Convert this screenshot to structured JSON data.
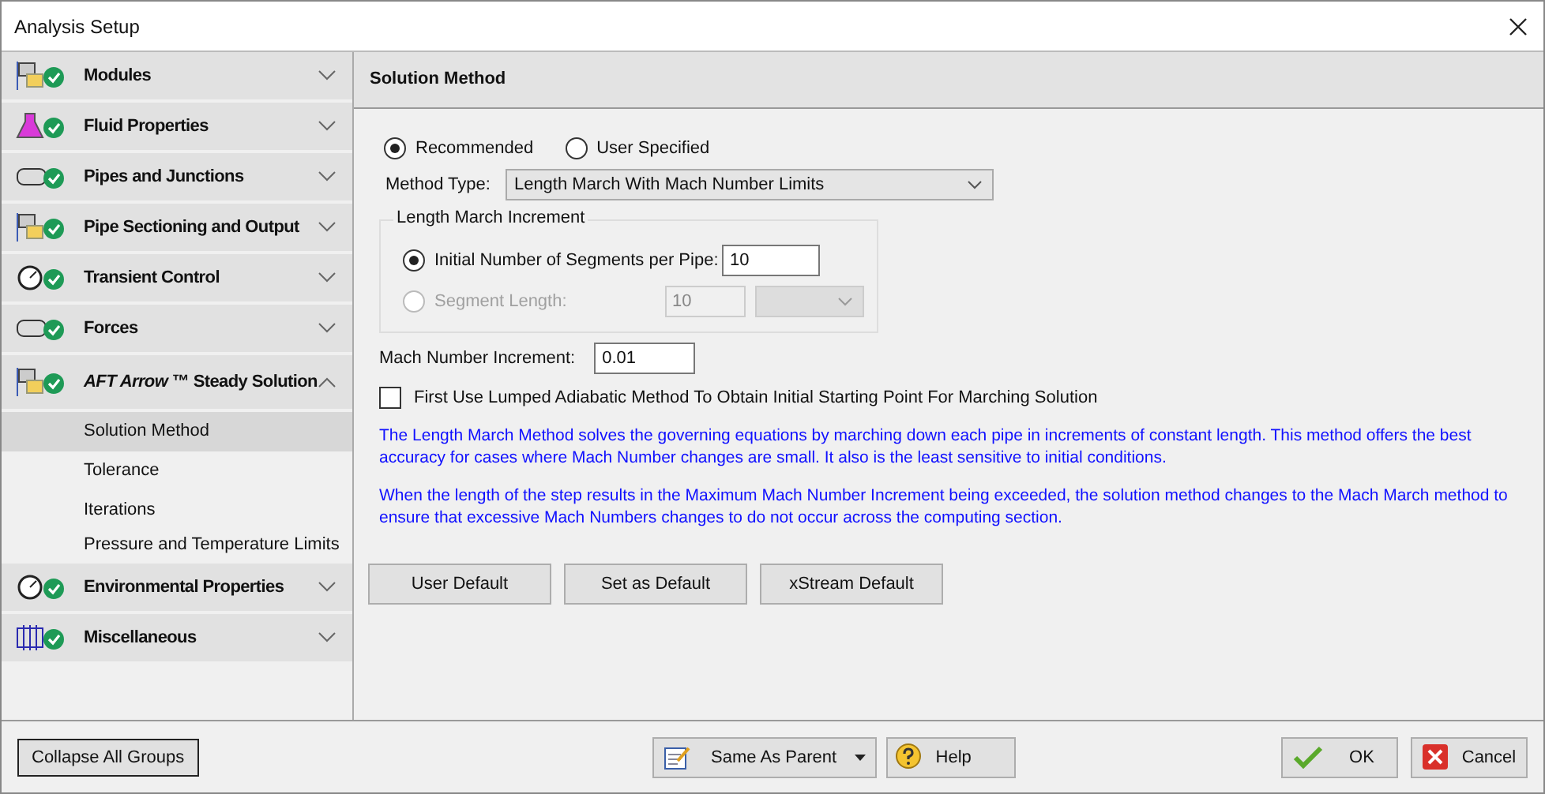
{
  "window": {
    "title": "Analysis Setup"
  },
  "sidebar": {
    "groups": [
      {
        "label": "Modules",
        "expanded": false
      },
      {
        "label": "Fluid Properties",
        "expanded": false
      },
      {
        "label": "Pipes and Junctions",
        "expanded": false
      },
      {
        "label": "Pipe Sectioning and Output",
        "expanded": false
      },
      {
        "label": "Transient Control",
        "expanded": false
      },
      {
        "label": "Forces",
        "expanded": false
      },
      {
        "label": "*AFT Arrow* ™ Steady Solution",
        "expanded": true,
        "children": [
          {
            "label": "Solution Method",
            "selected": true
          },
          {
            "label": "Tolerance",
            "selected": false
          },
          {
            "label": "Iterations",
            "selected": false
          },
          {
            "label": "Pressure and Temperature Limits",
            "selected": false
          }
        ]
      },
      {
        "label": "Environmental Properties",
        "expanded": false
      },
      {
        "label": "Miscellaneous",
        "expanded": false
      }
    ]
  },
  "panel": {
    "title": "Solution Method",
    "method_choice": [
      {
        "label": "Recommended",
        "selected": true
      },
      {
        "label": "User Specified",
        "selected": false
      }
    ],
    "method_type": {
      "label": "Method Type:",
      "value": "Length March With Mach Number Limits"
    },
    "length_march": {
      "title": "Length March Increment",
      "options": [
        {
          "label": "Initial Number of Segments per Pipe:",
          "selected": true,
          "disabled": false,
          "value": "10",
          "has_unit": false
        },
        {
          "label": "Segment Length:",
          "selected": false,
          "disabled": true,
          "value": "10",
          "has_unit": true
        }
      ]
    },
    "mach_increment": {
      "label": "Mach Number Increment:",
      "value": "0.01"
    },
    "lumped_option": {
      "label": "First Use Lumped Adiabatic Method To Obtain Initial Starting Point For Marching Solution",
      "checked": false
    },
    "notes": [
      "The Length March Method solves the governing equations by marching down each pipe in increments of constant length. This method offers the best accuracy for cases where Mach Number changes are small. It also is the least sensitive to initial conditions.",
      "When the length of the step results in the Maximum Mach Number Increment being exceeded, the solution method changes to the Mach March method to ensure that excessive Mach Numbers changes to do not occur across the computing section."
    ],
    "buttons": [
      "User Default",
      "Set as Default",
      "xStream Default"
    ]
  },
  "footer": {
    "collapse": "Collapse All Groups",
    "parent": "Same As Parent",
    "help": "Help",
    "ok": "OK",
    "cancel": "Cancel"
  }
}
